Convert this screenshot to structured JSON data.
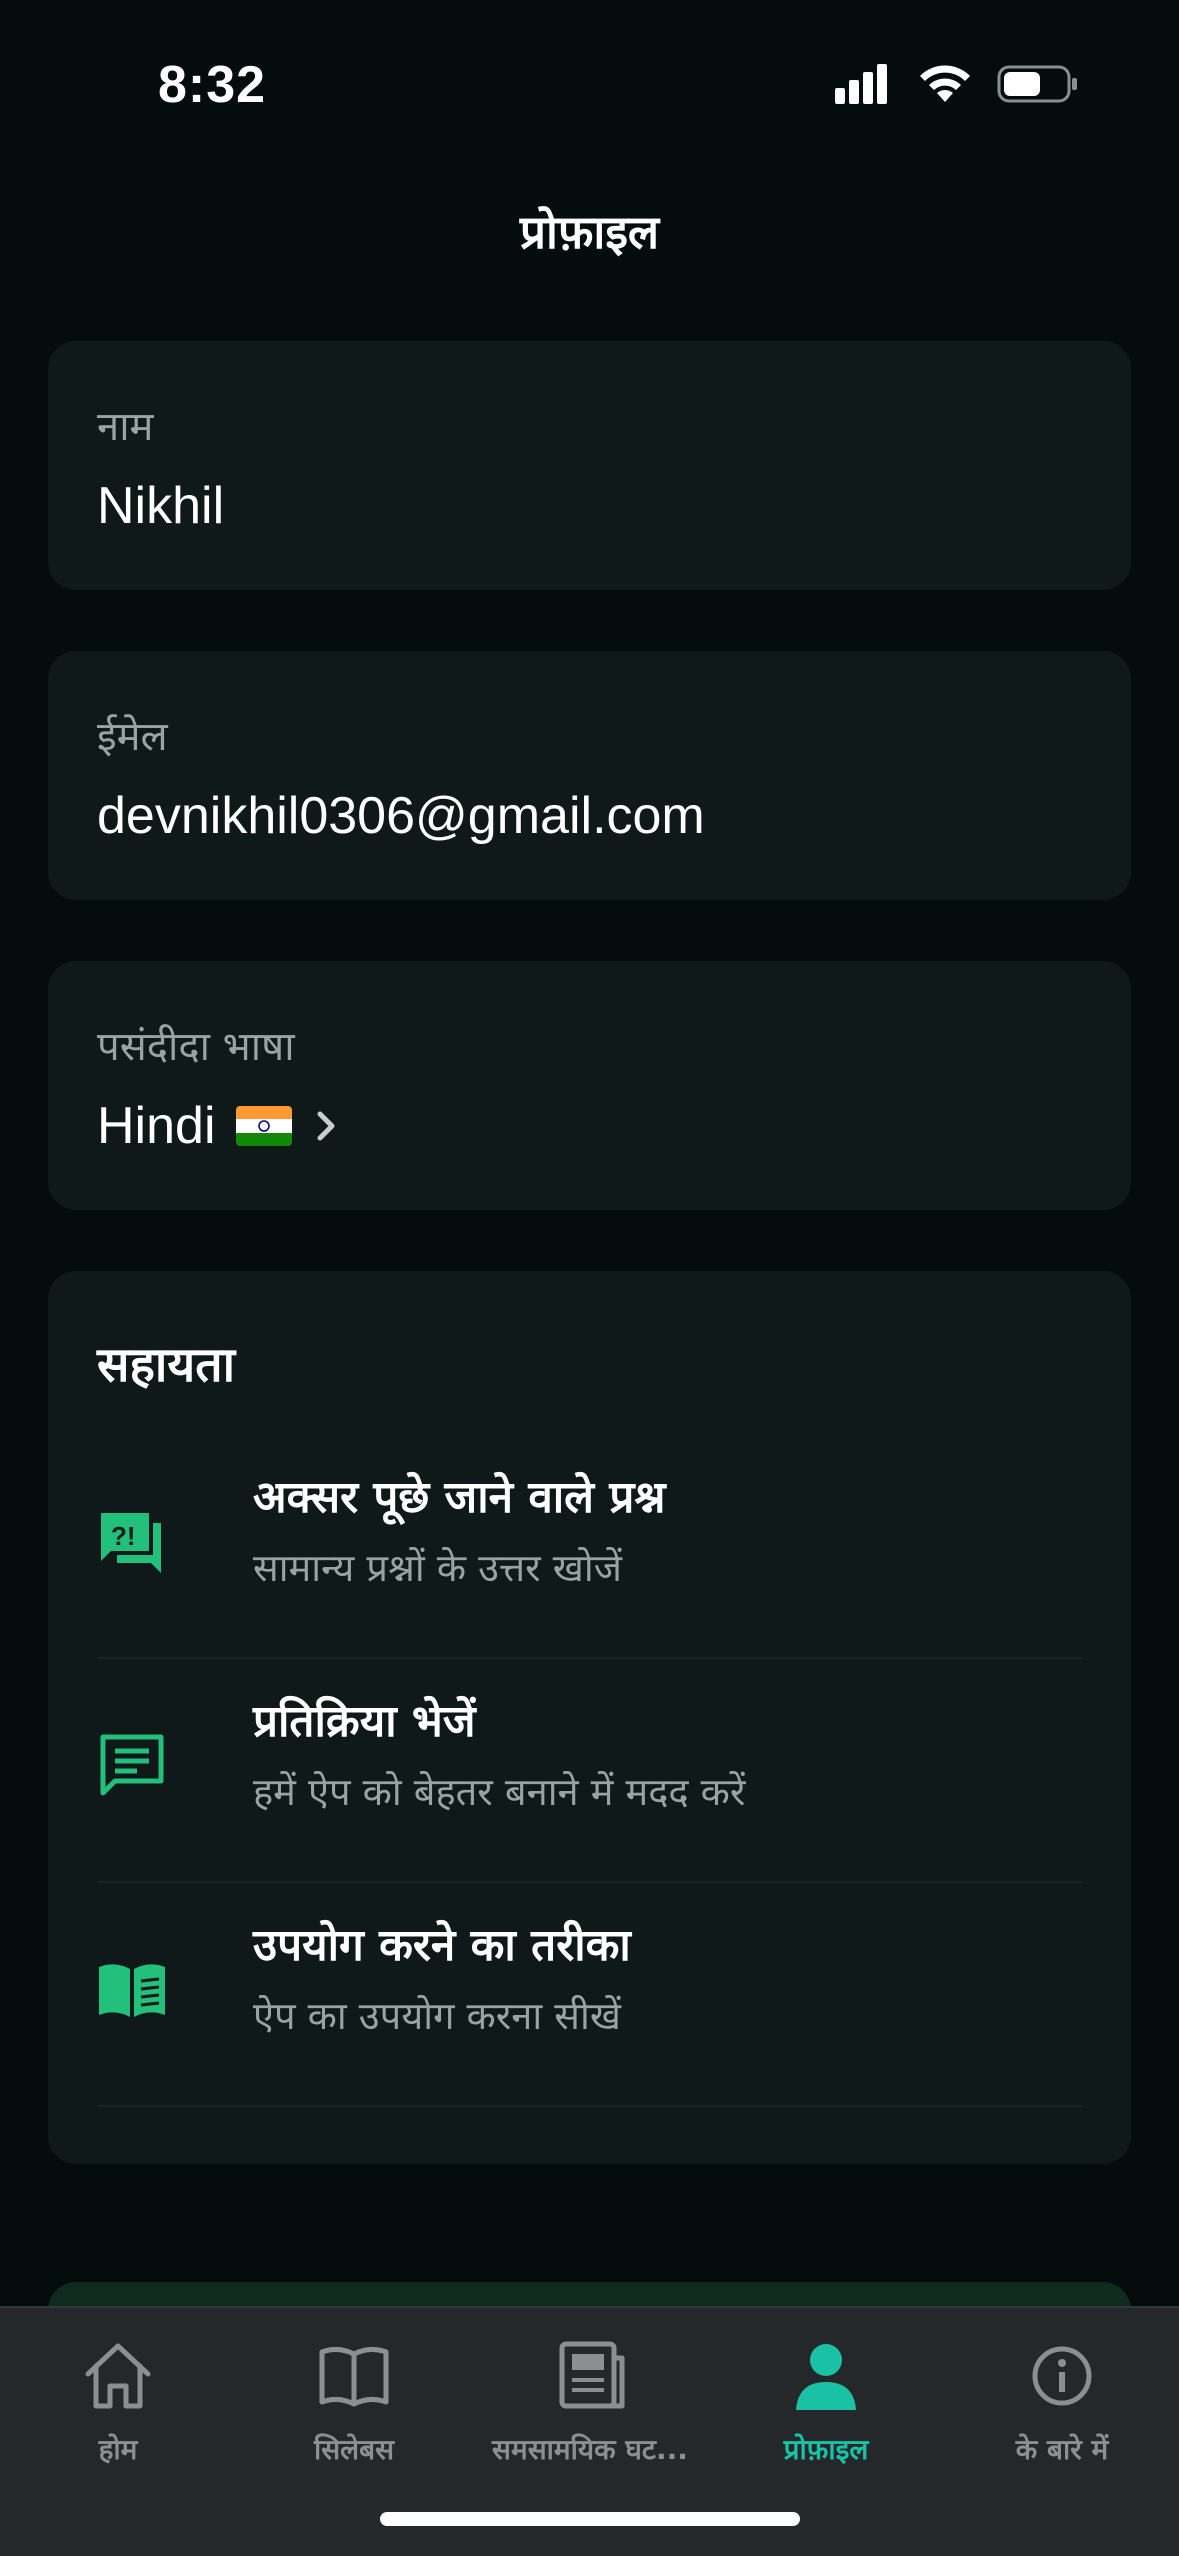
{
  "status_bar": {
    "time": "8:32"
  },
  "header": {
    "title": "प्रोफ़ाइल"
  },
  "profile": {
    "name_label": "नाम",
    "name_value": "Nikhil",
    "email_label": "ईमेल",
    "email_value": "devnikhil0306@gmail.com",
    "language_label": "पसंदीदा भाषा",
    "language_value": "Hindi"
  },
  "help": {
    "title": "सहायता",
    "items": [
      {
        "title": "अक्सर पूछे जाने वाले प्रश्न",
        "subtitle": "सामान्य प्रश्नों के उत्तर खोजें",
        "icon": "faq-icon"
      },
      {
        "title": "प्रतिक्रिया भेजें",
        "subtitle": "हमें ऐप को बेहतर बनाने में मदद करें",
        "icon": "feedback-icon"
      },
      {
        "title": "उपयोग करने का तरीका",
        "subtitle": "ऐप का उपयोग करना सीखें",
        "icon": "book-icon"
      }
    ]
  },
  "tabbar": {
    "items": [
      {
        "label": "होम",
        "icon": "home-icon"
      },
      {
        "label": "सिलेबस",
        "icon": "book-open-icon"
      },
      {
        "label": "समसामयिक घट...",
        "icon": "newspaper-icon"
      },
      {
        "label": "प्रोफ़ाइल",
        "icon": "person-icon"
      },
      {
        "label": "के बारे में",
        "icon": "info-icon"
      }
    ],
    "active_index": 3
  },
  "colors": {
    "accent": "#1bc1a4",
    "icon_green": "#22c07a",
    "card": "#101919",
    "background": "#040c0c"
  }
}
